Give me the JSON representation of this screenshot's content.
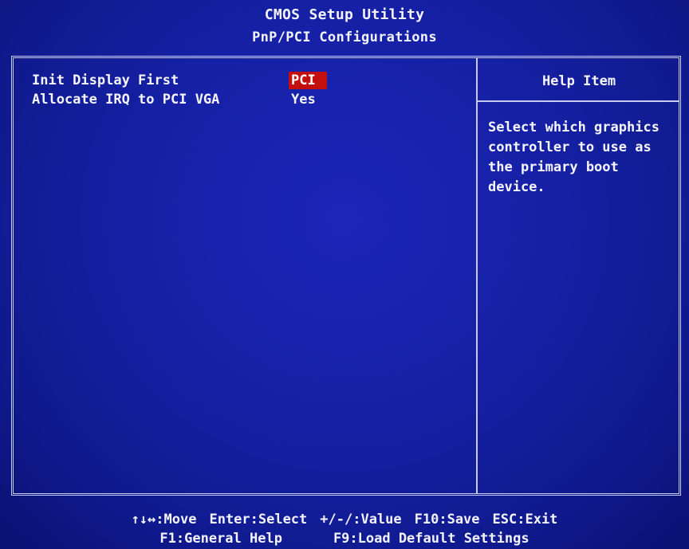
{
  "header": {
    "title": "CMOS Setup Utility",
    "subtitle": "PnP/PCI Configurations"
  },
  "settings": [
    {
      "label": "Init Display First",
      "value": "PCI",
      "selected": true
    },
    {
      "label": "Allocate IRQ to PCI VGA",
      "value": "Yes",
      "selected": false
    }
  ],
  "help": {
    "title": "Help Item",
    "text": "Select which graphics\ncontroller to use as\nthe primary boot\ndevice."
  },
  "footer": {
    "move": "↑↓↔:Move",
    "enter": "Enter:Select",
    "value": "+/-/:Value",
    "save": "F10:Save",
    "exit": "ESC:Exit",
    "general_help": "F1:General Help",
    "load_defaults": "F9:Load Default Settings"
  },
  "colors": {
    "background": "#1520a4",
    "selection": "#c40f0f",
    "text": "#ffffff",
    "border": "#c8ccf0"
  }
}
